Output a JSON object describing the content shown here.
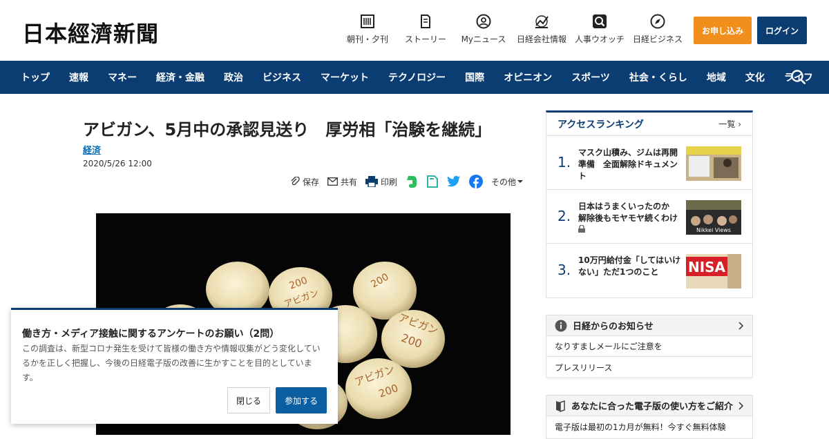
{
  "header": {
    "logo": "日本經濟新聞",
    "nav": [
      {
        "label": "朝刊・夕刊",
        "icon": "newspaper-icon"
      },
      {
        "label": "ストーリー",
        "icon": "story-icon"
      },
      {
        "label": "Myニュース",
        "icon": "user-icon"
      },
      {
        "label": "日経会社情報",
        "icon": "chart-icon"
      },
      {
        "label": "人事ウオッチ",
        "icon": "person-search-icon"
      },
      {
        "label": "日経ビジネス",
        "icon": "compass-icon"
      }
    ],
    "apply_label": "お申し込み",
    "login_label": "ログイン",
    "colors": {
      "apply": "#f28e1c",
      "brand": "#0b3d72"
    }
  },
  "navbar": {
    "items": [
      "トップ",
      "速報",
      "マネー",
      "経済・金融",
      "政治",
      "ビジネス",
      "マーケット",
      "テクノロジー",
      "国際",
      "オピニオン",
      "スポーツ",
      "社会・くらし",
      "地域",
      "文化",
      "ライフ"
    ],
    "search_icon": "search-icon"
  },
  "article": {
    "title": "アビガン、5月中の承認見送り　厚労相「治験を継続」",
    "category": "経済",
    "date": "2020/5/26 12:00",
    "share": {
      "save": "保存",
      "share": "共有",
      "print": "印刷",
      "more": "その他"
    },
    "pills": [
      {
        "line1": "アビガン",
        "line2": "200"
      }
    ]
  },
  "ranking": {
    "title": "アクセスランキング",
    "more": "一覧",
    "items": [
      {
        "num": "1.",
        "text": "マスク山積み、ジムは再開準備　全面解除ドキュメント"
      },
      {
        "num": "2.",
        "text": "日本はうまくいったのか　解除後もモヤモヤ続くわけ"
      },
      {
        "num": "3.",
        "text": "10万円給付金「してはいけない」ただ1つのこと"
      }
    ],
    "thumb2_caption": "Nikkei Views",
    "thumb3_caption": "NISA"
  },
  "notice": {
    "title": "日経からのお知らせ",
    "rows": [
      "なりすましメールにご注意を",
      "プレスリリース"
    ]
  },
  "guide": {
    "title": "あなたに合った電子版の使い方をご紹介",
    "rows": [
      "電子版は最初の1カ月が無料！今すぐ無料体験"
    ]
  },
  "survey": {
    "title": "働き方・メディア接触に関するアンケートのお願い（2問）",
    "desc": "この調査は、新型コロナ発生を受けて皆様の働き方や情報収集がどう変化しているかを正しく把握し、今後の日経電子版の改善に生かすことを目的としています。",
    "close_label": "閉じる",
    "join_label": "参加する"
  }
}
